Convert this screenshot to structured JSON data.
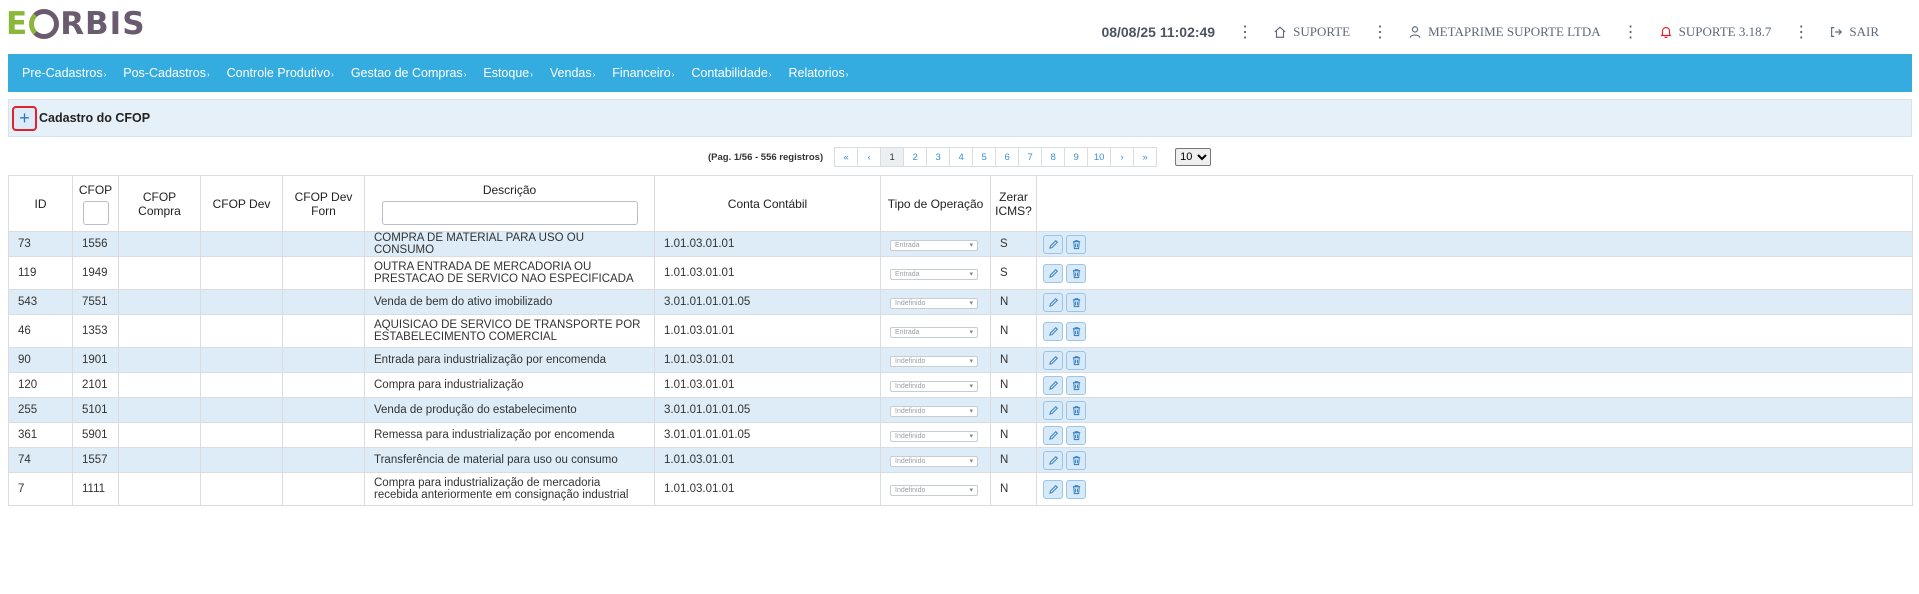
{
  "app": {
    "logo_first": "E",
    "logo_rest": "RBIS"
  },
  "header": {
    "datetime": "08/08/25 11:02:49",
    "support": "SUPORTE",
    "company": "METAPRIME SUPORTE LTDA",
    "version": "SUPORTE 3.18.7",
    "logout": "SAIR",
    "dots": "⋮"
  },
  "nav": {
    "items": [
      {
        "label": "Pre-Cadastros"
      },
      {
        "label": "Pos-Cadastros"
      },
      {
        "label": "Controle Produtivo"
      },
      {
        "label": "Gestao de Compras"
      },
      {
        "label": "Estoque"
      },
      {
        "label": "Vendas"
      },
      {
        "label": "Financeiro"
      },
      {
        "label": "Contabilidade"
      },
      {
        "label": "Relatorios"
      }
    ],
    "chevron": "›"
  },
  "page": {
    "add_symbol": "+",
    "title": "Cadastro do CFOP"
  },
  "pagination": {
    "info": "(Pag. 1/56 - 556 registros)",
    "first": "«",
    "prev": "‹",
    "next": "›",
    "last": "»",
    "pages": [
      "1",
      "2",
      "3",
      "4",
      "5",
      "6",
      "7",
      "8",
      "9",
      "10"
    ],
    "current": "1",
    "page_size": "10"
  },
  "table": {
    "columns": {
      "id": "ID",
      "cfop": "CFOP",
      "cfop_compra": "CFOP Compra",
      "cfop_dev": "CFOP Dev",
      "cfop_dev_forn": "CFOP Dev Forn",
      "descricao": "Descrição",
      "conta_contabil": "Conta Contábil",
      "tipo_operacao": "Tipo de Operação",
      "zerar_icms": "Zerar ICMS?"
    },
    "rows": [
      {
        "id": "73",
        "cfop": "1556",
        "cfop_compra": "",
        "cfop_dev": "",
        "cfop_dev_forn": "",
        "descricao": "COMPRA DE MATERIAL PARA USO OU CONSUMO",
        "conta": "1.01.03.01.01",
        "tipo": "Entrada",
        "zerar": "S"
      },
      {
        "id": "119",
        "cfop": "1949",
        "cfop_compra": "",
        "cfop_dev": "",
        "cfop_dev_forn": "",
        "descricao": "OUTRA ENTRADA DE MERCADORIA OU PRESTACAO DE SERVICO NAO ESPECIFICADA",
        "conta": "1.01.03.01.01",
        "tipo": "Entrada",
        "zerar": "S"
      },
      {
        "id": "543",
        "cfop": "7551",
        "cfop_compra": "",
        "cfop_dev": "",
        "cfop_dev_forn": "",
        "descricao": "Venda de bem do ativo imobilizado",
        "conta": "3.01.01.01.01.05",
        "tipo": "Indefinido",
        "zerar": "N"
      },
      {
        "id": "46",
        "cfop": "1353",
        "cfop_compra": "",
        "cfop_dev": "",
        "cfop_dev_forn": "",
        "descricao": "AQUISICAO DE SERVICO DE TRANSPORTE POR ESTABELECIMENTO COMERCIAL",
        "conta": "1.01.03.01.01",
        "tipo": "Entrada",
        "zerar": "N"
      },
      {
        "id": "90",
        "cfop": "1901",
        "cfop_compra": "",
        "cfop_dev": "",
        "cfop_dev_forn": "",
        "descricao": "Entrada para industrialização por encomenda",
        "conta": "1.01.03.01.01",
        "tipo": "Indefinido",
        "zerar": "N"
      },
      {
        "id": "120",
        "cfop": "2101",
        "cfop_compra": "",
        "cfop_dev": "",
        "cfop_dev_forn": "",
        "descricao": "Compra para industrialização",
        "conta": "1.01.03.01.01",
        "tipo": "Indefinido",
        "zerar": "N"
      },
      {
        "id": "255",
        "cfop": "5101",
        "cfop_compra": "",
        "cfop_dev": "",
        "cfop_dev_forn": "",
        "descricao": "Venda de produção do estabelecimento",
        "conta": "3.01.01.01.01.05",
        "tipo": "Indefinido",
        "zerar": "N"
      },
      {
        "id": "361",
        "cfop": "5901",
        "cfop_compra": "",
        "cfop_dev": "",
        "cfop_dev_forn": "",
        "descricao": "Remessa para industrialização por encomenda",
        "conta": "3.01.01.01.01.05",
        "tipo": "Indefinido",
        "zerar": "N"
      },
      {
        "id": "74",
        "cfop": "1557",
        "cfop_compra": "",
        "cfop_dev": "",
        "cfop_dev_forn": "",
        "descricao": "Transferência de material para uso ou consumo",
        "conta": "1.01.03.01.01",
        "tipo": "Indefinido",
        "zerar": "N"
      },
      {
        "id": "7",
        "cfop": "1111",
        "cfop_compra": "",
        "cfop_dev": "",
        "cfop_dev_forn": "",
        "descricao": "Compra para industrialização de mercadoria recebida anteriormente em consignação industrial",
        "conta": "1.01.03.01.01",
        "tipo": "Indefinido",
        "zerar": "N"
      }
    ]
  },
  "colors": {
    "nav_bg": "#34ace0",
    "row_alt": "#ddecf7",
    "add_border": "#e0222a",
    "logo_green": "#8bb83a",
    "logo_purple": "#6b5b6e"
  },
  "icons": {
    "edit": "pencil-icon",
    "delete": "trash-icon",
    "home": "home-icon",
    "user": "user-icon",
    "bell": "bell-icon",
    "logout": "logout-icon"
  }
}
